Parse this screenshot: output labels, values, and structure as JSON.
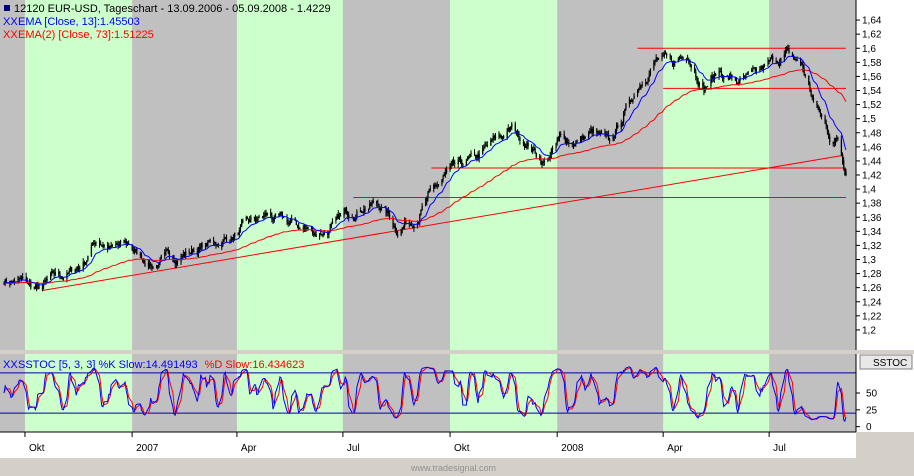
{
  "header": {
    "title": "12120  EUR-USD, Tageschart - 13.09.2006 - 05.09.2008 - 1.4229",
    "ema13_label": "EMA [Close, 13]:1.45503",
    "ema73_label": "EMA(2) [Close, 73]:1.51225",
    "legend_marker": "XX"
  },
  "lower_panel": {
    "title_label": "SSTOC [5, 3, 3] %K Slow:14.491493 %D Slow:16.434623",
    "k_part": "SSTOC [5, 3, 3] %K Slow:14.491493",
    "d_part": "%D Slow:16.434623",
    "right_tab": "SSTOC"
  },
  "footer": {
    "watermark": "www.tradesignal.com"
  },
  "colors": {
    "price": "#000000",
    "ema13": "#0000ff",
    "ema73": "#ff0000",
    "band_green": "#ccffcc",
    "band_gray": "#c0c0c0",
    "stoch_k": "#0000ff",
    "stoch_d": "#ff0000"
  },
  "chart_data": {
    "type": "candlestick",
    "instrument": "EUR-USD",
    "ylim": [
      1.18,
      1.66
    ],
    "y_ticks": [
      "1,2",
      "1,22",
      "1,24",
      "1,26",
      "1,28",
      "1,3",
      "1,32",
      "1,34",
      "1,36",
      "1,38",
      "1,4",
      "1,42",
      "1,44",
      "1,46",
      "1,48",
      "1,5",
      "1,52",
      "1,54",
      "1,56",
      "1,58",
      "1,6",
      "1,62",
      "1,64"
    ],
    "x_ticks": [
      "Okt",
      "2007",
      "Apr",
      "Jul",
      "Okt",
      "2008",
      "Apr",
      "Jul"
    ],
    "price_path": [
      [
        "2006-09-13",
        1.272
      ],
      [
        "2006-09-28",
        1.268
      ],
      [
        "2006-10-13",
        1.256
      ],
      [
        "2006-10-27",
        1.274
      ],
      [
        "2006-11-08",
        1.28
      ],
      [
        "2006-11-20",
        1.295
      ],
      [
        "2006-12-01",
        1.33
      ],
      [
        "2006-12-15",
        1.315
      ],
      [
        "2006-12-29",
        1.32
      ],
      [
        "2007-01-05",
        1.307
      ],
      [
        "2007-01-19",
        1.293
      ],
      [
        "2007-02-02",
        1.302
      ],
      [
        "2007-02-16",
        1.31
      ],
      [
        "2007-03-02",
        1.318
      ],
      [
        "2007-03-16",
        1.325
      ],
      [
        "2007-03-30",
        1.335
      ],
      [
        "2007-04-13",
        1.35
      ],
      [
        "2007-04-27",
        1.362
      ],
      [
        "2007-05-11",
        1.352
      ],
      [
        "2007-05-25",
        1.346
      ],
      [
        "2007-06-08",
        1.338
      ],
      [
        "2007-06-22",
        1.345
      ],
      [
        "2007-07-06",
        1.366
      ],
      [
        "2007-07-20",
        1.38
      ],
      [
        "2007-08-03",
        1.377
      ],
      [
        "2007-08-16",
        1.345
      ],
      [
        "2007-08-31",
        1.36
      ],
      [
        "2007-09-14",
        1.39
      ],
      [
        "2007-09-28",
        1.42
      ],
      [
        "2007-10-12",
        1.432
      ],
      [
        "2007-10-26",
        1.445
      ],
      [
        "2007-11-09",
        1.468
      ],
      [
        "2007-11-23",
        1.485
      ],
      [
        "2007-12-07",
        1.465
      ],
      [
        "2007-12-21",
        1.438
      ],
      [
        "2008-01-04",
        1.47
      ],
      [
        "2008-01-18",
        1.468
      ],
      [
        "2008-02-01",
        1.48
      ],
      [
        "2008-02-15",
        1.46
      ],
      [
        "2008-02-29",
        1.512
      ],
      [
        "2008-03-14",
        1.56
      ],
      [
        "2008-03-26",
        1.585
      ],
      [
        "2008-04-09",
        1.575
      ],
      [
        "2008-04-22",
        1.595
      ],
      [
        "2008-05-06",
        1.547
      ],
      [
        "2008-05-20",
        1.567
      ],
      [
        "2008-06-03",
        1.552
      ],
      [
        "2008-06-17",
        1.556
      ],
      [
        "2008-07-01",
        1.575
      ],
      [
        "2008-07-15",
        1.592
      ],
      [
        "2008-07-29",
        1.575
      ],
      [
        "2008-08-08",
        1.525
      ],
      [
        "2008-08-22",
        1.475
      ],
      [
        "2008-08-29",
        1.47
      ],
      [
        "2008-09-05",
        1.423
      ]
    ],
    "ema13_last": 1.45503,
    "ema73_last": 1.51225,
    "horizontal_lines": [
      {
        "y": 1.6,
        "from": "2008-03-10",
        "to": "2008-09-05"
      },
      {
        "y": 1.543,
        "from": "2008-04-01",
        "to": "2008-09-05"
      },
      {
        "y": 1.43,
        "from": "2007-09-15",
        "to": "2008-09-05"
      },
      {
        "y": 1.388,
        "from": "2007-07-10",
        "to": "2008-09-05"
      }
    ],
    "trend_line": {
      "from": [
        "2006-10-16",
        1.256
      ],
      "to": [
        "2008-09-03",
        1.448
      ]
    },
    "stochastic": {
      "k_last": 14.491493,
      "d_last": 16.434623,
      "ylim": [
        -5,
        105
      ],
      "y_ticks": [
        0,
        25,
        50
      ],
      "levels": [
        20,
        80
      ]
    }
  }
}
